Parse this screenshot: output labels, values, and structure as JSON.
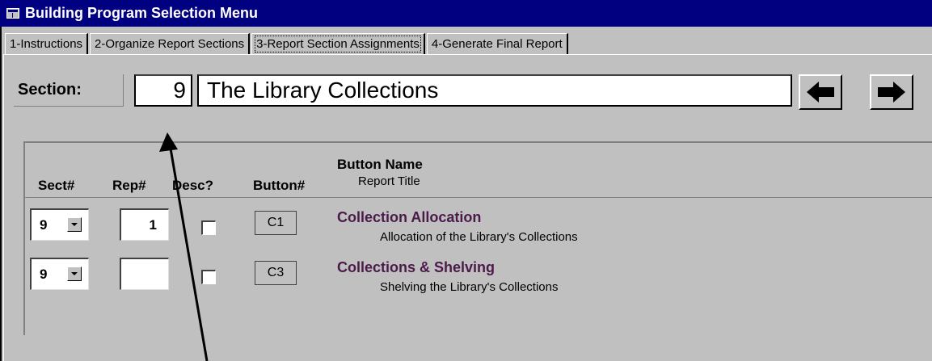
{
  "window": {
    "title": "Building Program Selection Menu"
  },
  "tabs": [
    {
      "label": "1-Instructions",
      "active": false
    },
    {
      "label": "2-Organize Report Sections",
      "active": false
    },
    {
      "label": "3-Report Section Assignments",
      "active": true
    },
    {
      "label": "4-Generate Final Report",
      "active": false
    }
  ],
  "section": {
    "label": "Section:",
    "number": "9",
    "name": "The Library Collections"
  },
  "navigation": {
    "prev_icon": "arrow-left-icon",
    "next_icon": "arrow-right-icon"
  },
  "columns": {
    "sect": "Sect#",
    "rep": "Rep#",
    "desc": "Desc?",
    "button": "Button#",
    "button_name": "Button Name",
    "report_title": "Report Title"
  },
  "rows": [
    {
      "sect": "9",
      "rep": "1",
      "desc_checked": false,
      "button_code": "C1",
      "button_name": "Collection Allocation",
      "report_title": "Allocation of the Library's Collections"
    },
    {
      "sect": "9",
      "rep": "",
      "desc_checked": false,
      "button_code": "C3",
      "button_name": "Collections & Shelving",
      "report_title": "Shelving the Library's Collections"
    }
  ],
  "colors": {
    "titlebar": "#000080",
    "face": "#c0c0c0",
    "button_name_text": "#4b1a4b"
  }
}
